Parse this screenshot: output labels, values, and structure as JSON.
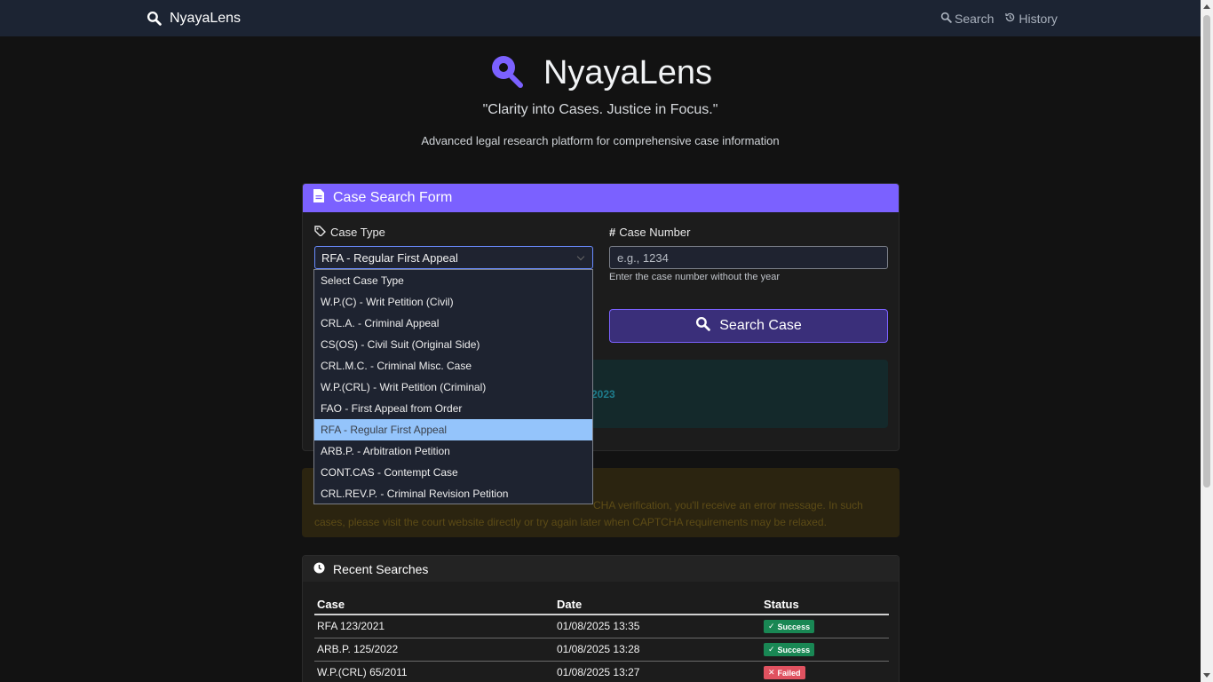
{
  "navbar": {
    "brand": "NyayaLens",
    "links": [
      {
        "label": "Search",
        "icon": "search-icon"
      },
      {
        "label": "History",
        "icon": "history-icon"
      }
    ]
  },
  "hero": {
    "title": "NyayaLens",
    "tagline": "\"Clarity into Cases. Justice in Focus.\"",
    "subtitle": "Advanced legal research platform for comprehensive case information"
  },
  "form": {
    "header": "Case Search Form",
    "case_type_label": "Case Type",
    "case_type_value": "RFA - Regular First Appeal",
    "case_number_label": "Case Number",
    "case_number_placeholder": "e.g., 1234",
    "case_number_help": "Enter the case number without the year",
    "search_button": "Search Case",
    "info_year_fragment": "2023"
  },
  "dropdown": {
    "options": [
      "Select Case Type",
      "W.P.(C) - Writ Petition (Civil)",
      "CRL.A. - Criminal Appeal",
      "CS(OS) - Civil Suit (Original Side)",
      "CRL.M.C. - Criminal Misc. Case",
      "W.P.(CRL) - Writ Petition (Criminal)",
      "FAO - First Appeal from Order",
      "RFA - Regular First Appeal",
      "ARB.P. - Arbitration Petition",
      "CONT.CAS - Contempt Case",
      "CRL.REV.P. - Criminal Revision Petition"
    ],
    "selected_index": 7
  },
  "warning": {
    "text": "CHA verification, you'll receive an error message. In such cases, please visit the court website directly or try again later when CAPTCHA requirements may be relaxed."
  },
  "recent": {
    "header": "Recent Searches",
    "columns": [
      "Case",
      "Date",
      "Status"
    ],
    "rows": [
      {
        "case": "RFA 123/2021",
        "date": "01/08/2025 13:35",
        "status": "Success",
        "type": "success"
      },
      {
        "case": "ARB.P. 125/2022",
        "date": "01/08/2025 13:28",
        "status": "Success",
        "type": "success"
      },
      {
        "case": "W.P.(CRL) 65/2011",
        "date": "01/08/2025 13:27",
        "status": "Failed",
        "type": "failed"
      }
    ]
  },
  "colors": {
    "accent": "#7b61ff",
    "navbar": "#1c2433",
    "success": "#198754",
    "failed": "#e05260"
  }
}
